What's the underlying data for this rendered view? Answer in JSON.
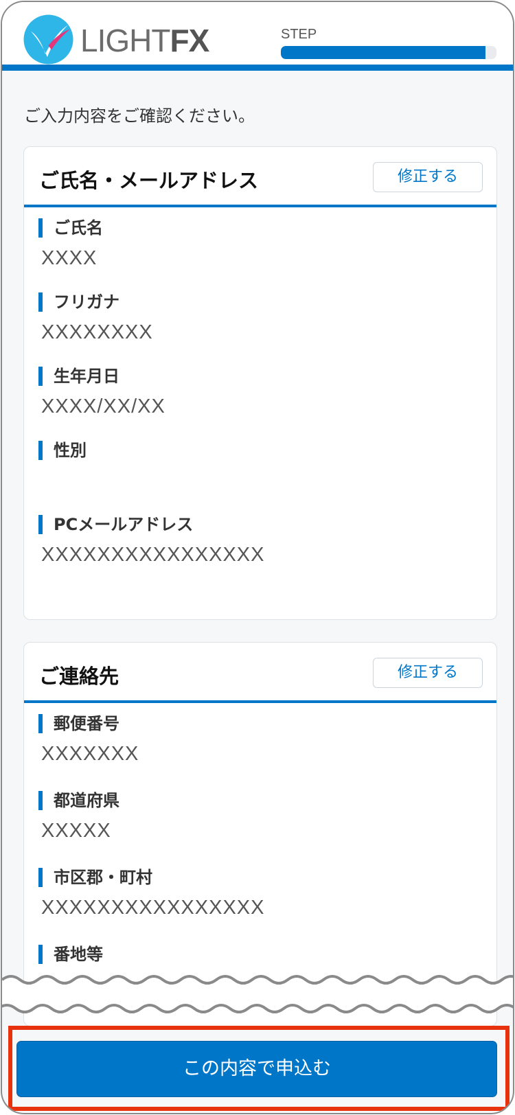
{
  "header": {
    "brand": "LIGHT",
    "brand_suffix": "FX",
    "step_label": "STEP",
    "step_progress": 0.95,
    "logo_icon": "light-fx-logo"
  },
  "intro": "ご入力内容をご確認ください。",
  "sections": [
    {
      "title": "ご氏名・メールアドレス",
      "edit_label": "修正する",
      "fields": [
        {
          "label": "ご氏名",
          "value": "XXXX"
        },
        {
          "label": "フリガナ",
          "value": "XXXXXXXX"
        },
        {
          "label": "生年月日",
          "value": "XXXX/XX/XX"
        },
        {
          "label": "性別",
          "value": ""
        },
        {
          "label": "PCメールアドレス",
          "value": "XXXXXXXXXXXXXXXX"
        }
      ]
    },
    {
      "title": "ご連絡先",
      "edit_label": "修正する",
      "fields": [
        {
          "label": "郵便番号",
          "value": "XXXXXXX"
        },
        {
          "label": "都道府県",
          "value": "XXXXX"
        },
        {
          "label": "市区郡・町村",
          "value": "XXXXXXXXXXXXXXXX"
        },
        {
          "label": "番地等",
          "value": ""
        }
      ]
    }
  ],
  "submit_label": "この内容で申込む",
  "colors": {
    "accent": "#0076c8",
    "highlight_frame": "#e8320e",
    "background": "#f6f7f8"
  }
}
